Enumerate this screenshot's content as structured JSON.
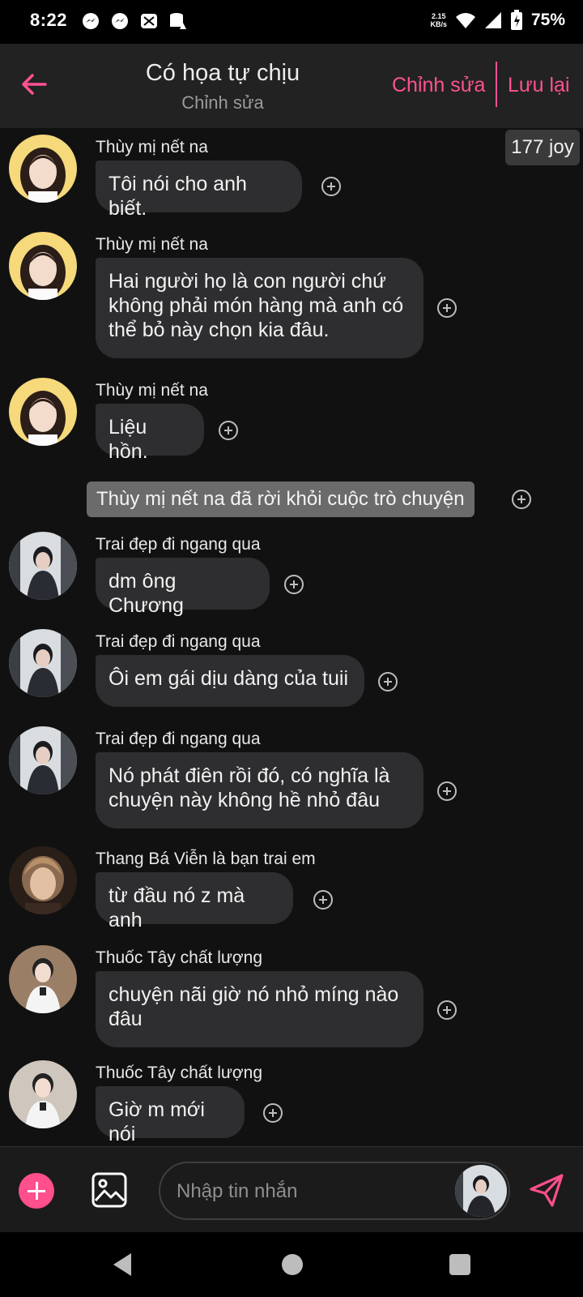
{
  "status_bar": {
    "time": "8:22",
    "net_speed_value": "2.15",
    "net_speed_unit": "KB/s",
    "battery": "75%",
    "icons": [
      "messenger-icon",
      "messenger-icon",
      "app-notification-icon",
      "storage-warning-icon",
      "wifi-icon",
      "signal-icon",
      "battery-charging-icon"
    ]
  },
  "header": {
    "title": "Có họa tự chịu",
    "subtitle": "Chỉnh sửa",
    "edit_label": "Chỉnh sửa",
    "save_label": "Lưu lại",
    "accent_color": "#ff5291"
  },
  "chat": {
    "joy_badge": "177 joy",
    "system_notice": "Thùy mị nết na đã rời khỏi cuộc trò chuyện",
    "messages": [
      {
        "sender": "Thùy mị nết na",
        "lines": [
          "Tôi nói cho anh biết."
        ]
      },
      {
        "sender": "Thùy mị nết na",
        "lines": [
          "Hai người họ là con người chứ",
          "không phải món hàng mà anh có",
          "thể bỏ này chọn kia đâu."
        ]
      },
      {
        "sender": "Thùy mị nết na",
        "lines": [
          "Liệu hồn."
        ]
      },
      {
        "sender": "Trai đẹp đi ngang qua",
        "lines": [
          "dm ông Chương"
        ]
      },
      {
        "sender": "Trai đẹp đi ngang qua",
        "lines": [
          "Ôi em gái dịu dàng của tuii"
        ]
      },
      {
        "sender": "Trai đẹp đi ngang qua",
        "lines": [
          "Nó phát điên rồi đó, có nghĩa là",
          "chuyện này không hề nhỏ đâu"
        ]
      },
      {
        "sender": "Thang Bá Viễn là bạn trai em",
        "lines": [
          "từ đầu nó z mà anh"
        ]
      },
      {
        "sender": "Thuốc Tây chất lượng",
        "lines": [
          "chuyện nãi giờ nó nhỏ míng nào",
          "đâu"
        ]
      },
      {
        "sender": "Thuốc Tây chất lượng",
        "lines": [
          "Giờ m mới nói"
        ]
      }
    ]
  },
  "composer": {
    "placeholder": "Nhập tin nhắn",
    "input_value": ""
  },
  "colors": {
    "background": "#111111",
    "bubble": "#2e2e30",
    "accent": "#ff4f8c"
  }
}
